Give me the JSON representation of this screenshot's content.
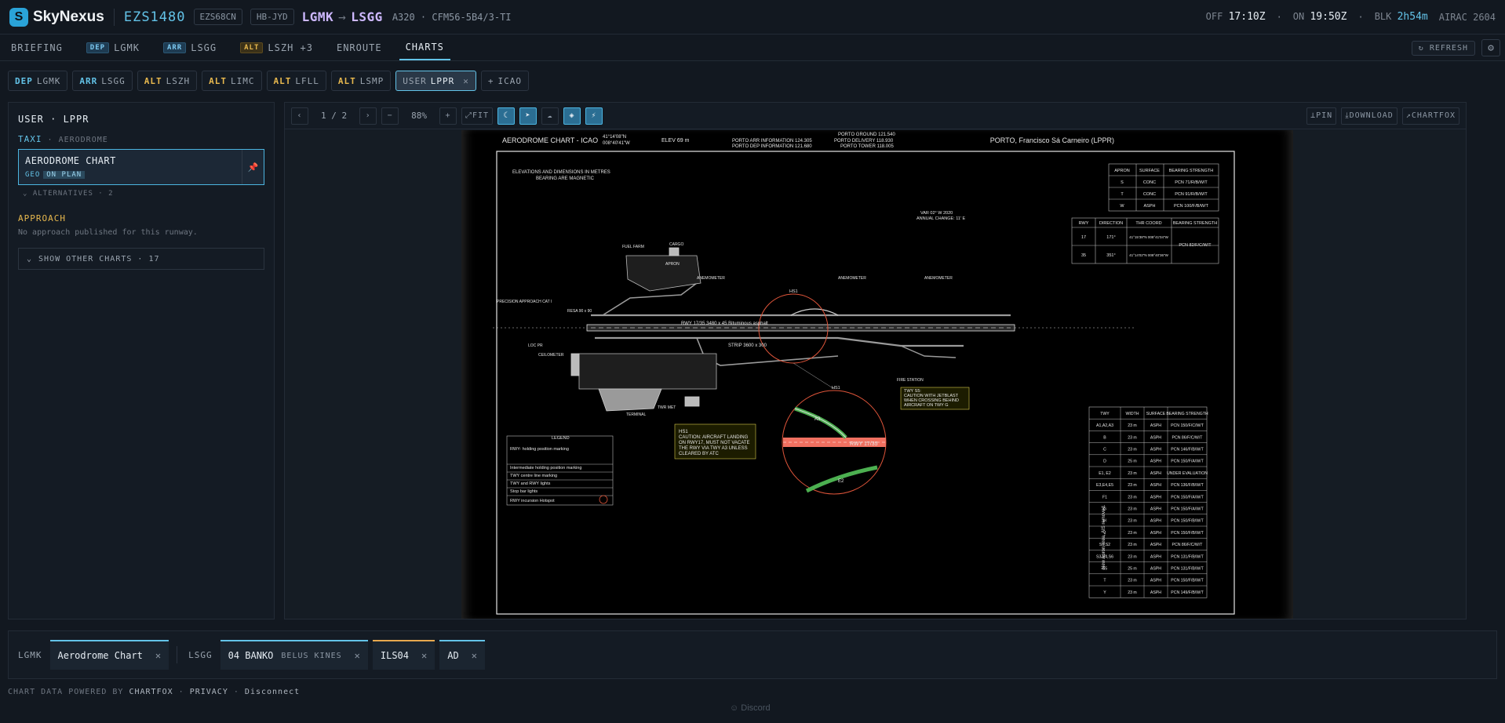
{
  "header": {
    "brand": "SkyNexus",
    "callsign": "EZS1480",
    "flight_code": "EZS68CN",
    "registration": "HB-JYD",
    "origin": "LGMK",
    "destination": "LSGG",
    "aircraft": "A320 · CFM56-5B4/3-TI",
    "off_label": "OFF",
    "off_time": "17:10Z",
    "on_label": "ON",
    "on_time": "19:50Z",
    "blk_label": "BLK",
    "blk_time": "2h54m",
    "airac": "AIRAC 2604"
  },
  "nav": {
    "briefing": "BRIEFING",
    "dep_tag": "DEP",
    "dep_code": "LGMK",
    "arr_tag": "ARR",
    "arr_code": "LSGG",
    "alt_tag": "ALT",
    "alt_code": "LSZH +3",
    "enroute": "ENROUTE",
    "charts": "CHARTS",
    "refresh": "REFRESH"
  },
  "airports": [
    {
      "kind": "DEP",
      "code": "LGMK"
    },
    {
      "kind": "ARR",
      "code": "LSGG"
    },
    {
      "kind": "ALT",
      "code": "LSZH"
    },
    {
      "kind": "ALT",
      "code": "LIMC"
    },
    {
      "kind": "ALT",
      "code": "LFLL"
    },
    {
      "kind": "ALT",
      "code": "LSMP"
    },
    {
      "kind": "USER",
      "code": "LPPR"
    }
  ],
  "add_icao": "ICAO",
  "panel": {
    "title": "USER · LPPR",
    "section_code": "TAXI",
    "section_sub": "· AERODROME",
    "chart_title": "AERODROME CHART",
    "tag_geo": "GEO",
    "tag_onplan": "ON PLAN",
    "alternatives": "ALTERNATIVES · 2",
    "approach_heading": "APPROACH",
    "approach_none": "No approach published for this runway.",
    "show_other": "SHOW OTHER CHARTS · 17"
  },
  "viewer": {
    "page": "1 / 2",
    "zoom": "88%",
    "fit": "FIT",
    "pin": "PIN",
    "download": "DOWNLOAD",
    "chartfox": "CHARTFOX"
  },
  "chart_doc": {
    "title": "AERODROME CHART - ICAO",
    "coord_lat": "41°14'08\"N",
    "coord_lon": "008°40'41\"W",
    "elev": "ELEV 69 m",
    "freq1": "PORTO ARR INFORMATION 124.305",
    "freq2": "PORTO DEP INFORMATION 121.680",
    "freq3": "PORTO GROUND 121.540",
    "freq4": "PORTO DELIVERY 118.930",
    "freq5": "PORTO TOWER 118.005",
    "airport": "PORTO, Francisco Sá Carneiro (LPPR)",
    "note_elev1": "ELEVATIONS AND DIMENSIONS IN METRES",
    "note_elev2": "BEARING ARE MAGNETIC",
    "var1": "VAR 02° W 2020",
    "var2": "ANNUAL CHANGE: 11' E",
    "rwy_label": "RWY 17/35  3480 x 45 Bituminous asphalt",
    "strip_label": "STRIP 3600 x 300",
    "hs1": "HS1",
    "hs1_note": [
      "HS1",
      "CAUTION: AIRCRAFT LANDING",
      "ON RWY17, MUST NOT VACATE",
      "THE RWY VIA TWY A3 UNLESS",
      "CLEARED BY ATC"
    ],
    "twy_note": [
      "TWY S5:",
      "CAUTION WITH JETBLAST",
      "WHEN CROSSING BEHIND",
      "AIRCRAFT ON TWY G"
    ],
    "apron_table": {
      "headers": [
        "APRON",
        "SURFACE",
        "BEARING STRENGTH"
      ],
      "rows": [
        [
          "S",
          "CONC",
          "PCN 71/R/B/W/T"
        ],
        [
          "T",
          "CONC",
          "PCN 91/R/B/W/T"
        ],
        [
          "W",
          "ASPH",
          "PCN 100/F/B/W/T"
        ]
      ]
    },
    "rwy_table": {
      "headers": [
        "RWY",
        "DIRECTION",
        "THR COORD",
        "BEARING STRENGTH"
      ],
      "rows": [
        [
          "17",
          "171°",
          "41°15'38\"N 008°41'04\"W",
          "PCN 82/F/C/W/T"
        ],
        [
          "35",
          "351°",
          "41°14'02\"N 008°40'36\"W",
          ""
        ]
      ]
    },
    "twy_table": {
      "headers": [
        "TWY",
        "WIDTH",
        "SURFACE",
        "BEARING STRENGTH"
      ],
      "rows": [
        [
          "A1,A2,A3",
          "23 m",
          "ASPH",
          "PCN 150/F/C/W/T"
        ],
        [
          "B",
          "23 m",
          "ASPH",
          "PCN 86/F/C/W/T"
        ],
        [
          "C",
          "23 m",
          "ASPH",
          "PCN 146/F/B/W/T"
        ],
        [
          "D",
          "25 m",
          "ASPH",
          "PCN 150/F/A/W/T"
        ],
        [
          "E1, E2",
          "23 m",
          "ASPH",
          "UNDER EVALUATION"
        ],
        [
          "E3,E4,E5",
          "23 m",
          "ASPH",
          "PCN 136/F/B/W/T"
        ],
        [
          "F1",
          "23 m",
          "ASPH",
          "PCN 150/F/A/W/T"
        ],
        [
          "G",
          "23 m",
          "ASPH",
          "PCN 150/F/A/W/T"
        ],
        [
          "H",
          "23 m",
          "ASPH",
          "PCN 150/F/B/W/T"
        ],
        [
          "J",
          "23 m",
          "ASPH",
          "PCN 150/F/B/W/T"
        ],
        [
          "S1,S2",
          "23 m",
          "ASPH",
          "PCN 86/F/C/W/T"
        ],
        [
          "S3,S4,S6",
          "23 m",
          "ASPH",
          "PCN 131/F/B/W/T"
        ],
        [
          "S5",
          "25 m",
          "ASPH",
          "PCN 131/F/B/W/T"
        ],
        [
          "T",
          "23 m",
          "ASPH",
          "PCN 150/F/B/W/T"
        ],
        [
          "Y",
          "23 m",
          "ASPH",
          "PCN 149/F/B/W/T"
        ]
      ]
    },
    "legend_title": "LEGEND",
    "legend_rows": [
      "RWY- holding position marking",
      "Intermediate holding position marking",
      "TWY centre line marking",
      "TWY and RWY lights",
      "Stop bar lights",
      "RWY incursion Hotspot"
    ],
    "side_note": "New Apron area, AIS removed.",
    "labels": [
      "FUEL FARM",
      "CARGO",
      "APRON",
      "ANEMOMETER",
      "TERMINAL",
      "TWR MET",
      "FIRE STATION",
      "CEILOMETER",
      "LOC PR",
      "RESA 90 x 90",
      "PRECISION APPROACH CAT I"
    ]
  },
  "bottom_tabs": [
    {
      "group": "LGMK",
      "label": "Aerodrome Chart",
      "sub": ""
    },
    {
      "group": "LSGG",
      "label": "04 BANKO",
      "sub": "BELUS KINES"
    },
    {
      "group": "",
      "label": "ILS04",
      "sub": ""
    },
    {
      "group": "",
      "label": "AD",
      "sub": ""
    }
  ],
  "footer": {
    "powered": "CHART DATA POWERED BY",
    "chartfox": "CHARTFOX",
    "privacy": "PRIVACY",
    "disconnect": "Disconnect",
    "discord": "Discord"
  },
  "colors": {
    "accent": "#63c3e8",
    "alt": "#e7b84e",
    "route": "#cdb8ff",
    "hotspot": "#e0553a"
  }
}
